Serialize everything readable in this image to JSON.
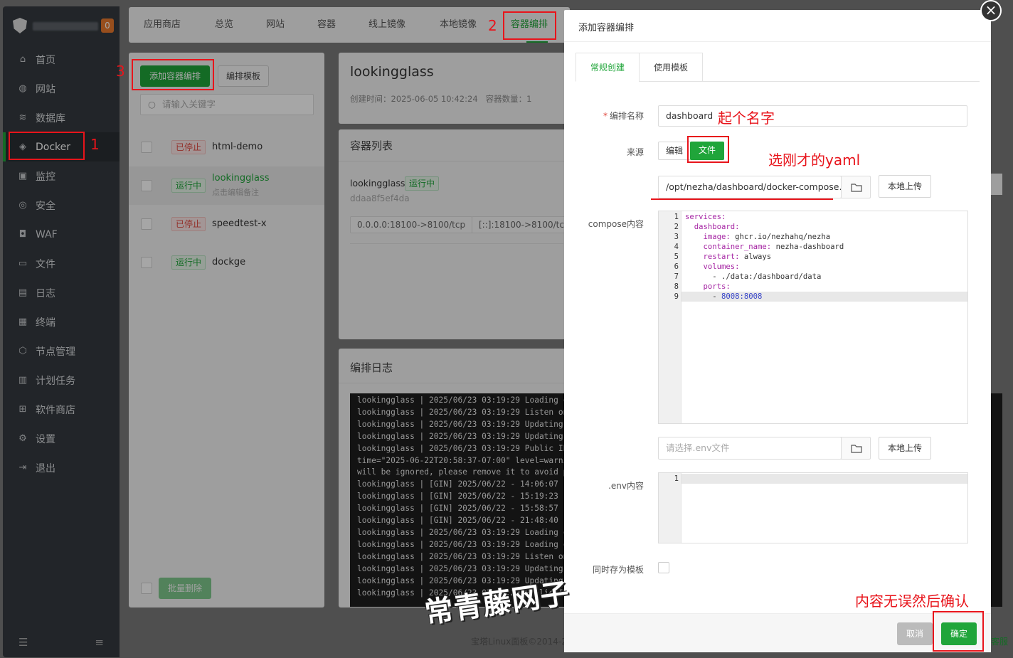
{
  "sidebar": {
    "badge": "0",
    "items": [
      {
        "label": "首页",
        "icon": "home-icon",
        "glyph": "⌂"
      },
      {
        "label": "网站",
        "icon": "globe-icon",
        "glyph": "◍"
      },
      {
        "label": "数据库",
        "icon": "database-icon",
        "glyph": "≋"
      },
      {
        "label": "Docker",
        "icon": "docker-icon",
        "glyph": "◈"
      },
      {
        "label": "监控",
        "icon": "monitor-icon",
        "glyph": "▣"
      },
      {
        "label": "安全",
        "icon": "shield-icon",
        "glyph": "◎"
      },
      {
        "label": "WAF",
        "icon": "waf-icon",
        "glyph": "◘"
      },
      {
        "label": "文件",
        "icon": "folder-icon",
        "glyph": "▭"
      },
      {
        "label": "日志",
        "icon": "log-icon",
        "glyph": "▤"
      },
      {
        "label": "终端",
        "icon": "terminal-icon",
        "glyph": "▦"
      },
      {
        "label": "节点管理",
        "icon": "node-icon",
        "glyph": "⬡"
      },
      {
        "label": "计划任务",
        "icon": "cron-icon",
        "glyph": "▥"
      },
      {
        "label": "软件商店",
        "icon": "store-icon",
        "glyph": "⊞"
      },
      {
        "label": "设置",
        "icon": "gear-icon",
        "glyph": "⚙"
      },
      {
        "label": "退出",
        "icon": "logout-icon",
        "glyph": "⇥"
      }
    ]
  },
  "topbar": {
    "tabs": [
      "应用商店",
      "总览",
      "网站",
      "容器",
      "线上镜像",
      "本地镜像",
      "容器编排"
    ]
  },
  "left_panel": {
    "add_button": "添加容器编排",
    "template_button": "编排模板",
    "search_placeholder": "请输入关键字",
    "rows": [
      {
        "status": "已停止",
        "name": "html-demo"
      },
      {
        "status": "运行中",
        "name": "lookingglass",
        "remark": "点击编辑备注"
      },
      {
        "status": "已停止",
        "name": "speedtest-x"
      },
      {
        "status": "运行中",
        "name": "dockge"
      }
    ],
    "batch_delete": "批量删除"
  },
  "detail": {
    "title": "lookingglass",
    "meta": "创建时间：2025-06-05 10:42:24   容器数量：1",
    "container_list_title": "容器列表",
    "container_name": "lookingglass",
    "container_status": "运行中",
    "container_id": "ddaa8f5ef4da",
    "ports": [
      "0.0.0.0:18100->8100/tcp",
      "[::]:18100->8100/tcp"
    ],
    "log_title": "编排日志",
    "log_lines": [
      "lookingglass | 2025/06/23 03:19:29 Loading c",
      "lookingglass | 2025/06/23 03:19:29 Listen on",
      "lookingglass | 2025/06/23 03:19:29 Updating",
      "lookingglass | 2025/06/23 03:19:29 Updating",
      "lookingglass | 2025/06/23 03:19:29 Public IP",
      "time=\"2025-06-22T20:58:37-07:00\" level=warni",
      "will be ignored, please remove it to avoid p",
      "lookingglass | [GIN] 2025/06/22 - 14:06:07 |",
      "lookingglass | [GIN] 2025/06/22 - 15:19:23 |",
      "lookingglass | [GIN] 2025/06/22 - 15:58:57 |",
      "lookingglass | [GIN] 2025/06/22 - 21:48:40 |",
      "lookingglass | 2025/06/23 03:19:29 Loading c",
      "lookingglass | 2025/06/23 03:19:29 Loading c",
      "lookingglass | 2025/06/23 03:19:29 Listen on",
      "lookingglass | 2025/06/23 03:19:29 Updating",
      "lookingglass | 2025/06/23 03:19:29 Updating",
      "lookingglass | 2025/06/23 03:19:29 Public IP"
    ]
  },
  "footer_text": "宝塔Linux面板©2014-2",
  "footer_right": "客服",
  "modal": {
    "title": "添加容器编排",
    "tabs": [
      "常规创建",
      "使用模板"
    ],
    "name_label": "编排名称",
    "name_value": "dashboard",
    "source_label": "来源",
    "source_edit": "编辑",
    "source_file": "文件",
    "file_path": "/opt/nezha/dashboard/docker-compose.y",
    "upload_label": "本地上传",
    "compose_label": "compose内容",
    "compose_lines": [
      [
        {
          "t": "services:",
          "c": "k"
        }
      ],
      [
        {
          "t": "  dashboard:",
          "c": "k"
        }
      ],
      [
        {
          "t": "    image: ",
          "c": "k"
        },
        {
          "t": "ghcr.io/nezhahq/nezha",
          "c": "s"
        }
      ],
      [
        {
          "t": "    container_name: ",
          "c": "k"
        },
        {
          "t": "nezha-dashboard",
          "c": "s"
        }
      ],
      [
        {
          "t": "    restart: ",
          "c": "k"
        },
        {
          "t": "always",
          "c": "s"
        }
      ],
      [
        {
          "t": "    volumes:",
          "c": "k"
        }
      ],
      [
        {
          "t": "      - ./data:/dashboard/data",
          "c": "s"
        }
      ],
      [
        {
          "t": "    ports:",
          "c": "k"
        }
      ],
      [
        {
          "t": "      - ",
          "c": "s"
        },
        {
          "t": "8008:8008",
          "c": "n"
        }
      ]
    ],
    "env_placeholder": "请选择.env文件",
    "env_label": ".env内容",
    "env_line_number": "1",
    "save_template_label": "同时存为模板",
    "cancel": "取消",
    "confirm": "确定"
  },
  "annotations": {
    "n1": "1",
    "n2": "2",
    "n3": "3",
    "name_hint": "起个名字",
    "yaml_hint": "选刚才的yaml",
    "confirm_hint": "内容无误然后确认",
    "watermark": "常青藤网子"
  }
}
